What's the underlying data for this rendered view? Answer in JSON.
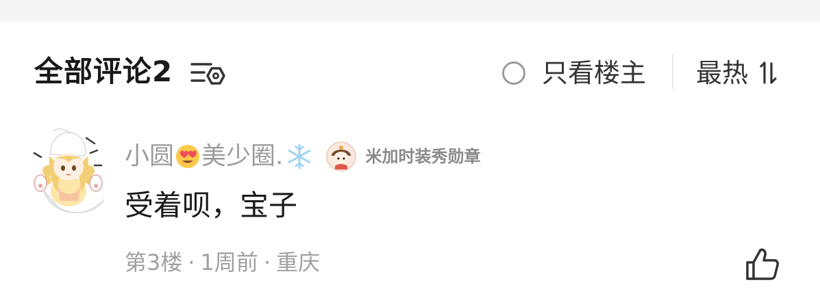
{
  "header": {
    "title": "全部评论2",
    "only_op_label": "只看楼主",
    "sort_label": "最热"
  },
  "icons": {
    "filter": "filter-settings-icon",
    "radio": "radio-unchecked-icon",
    "sort": "sort-arrows-icon",
    "like": "thumbs-up-icon",
    "emoji": "heart-eyes-emoji-icon",
    "snowflake": "snowflake-icon",
    "badge": "medal-badge-icon"
  },
  "comment": {
    "username_part1": "小圆",
    "username_part2": "美少圈.",
    "badge_label": "米加时装秀勋章",
    "text": "受着呗，宝子",
    "floor": "第3楼",
    "time": "1周前",
    "location": "重庆",
    "separator": "·"
  },
  "colors": {
    "title": "#1a1a1a",
    "secondary_text": "#9b9b9b",
    "meta_text": "#a0a0a0",
    "divider": "#e8e8e8",
    "top_strip": "#f5f5f5"
  }
}
